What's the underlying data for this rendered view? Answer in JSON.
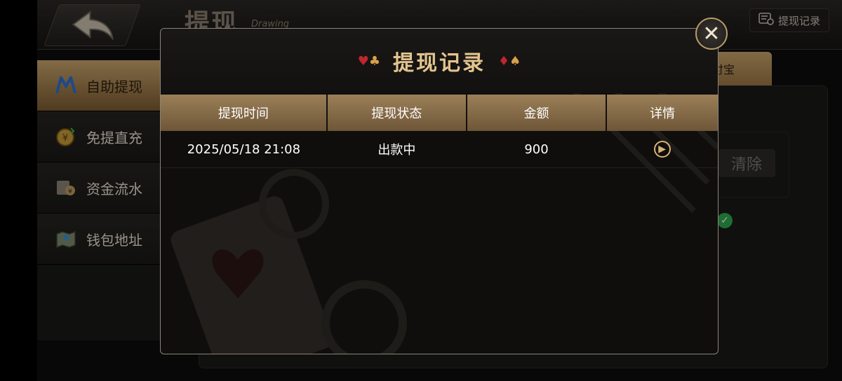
{
  "header": {
    "title": "提现",
    "subtitle": "Drawing",
    "record_link": "提现记录"
  },
  "sidebar": {
    "items": [
      {
        "label": "自助提现",
        "icon": "m-logo-icon",
        "active": true
      },
      {
        "label": "免提直充",
        "icon": "coin-icon",
        "active": false
      },
      {
        "label": "资金流水",
        "icon": "ledger-icon",
        "active": false
      },
      {
        "label": "钱包地址",
        "icon": "map-wallet-icon",
        "active": false
      }
    ]
  },
  "background": {
    "tab_label": "付宝",
    "clear_label": "清除"
  },
  "modal": {
    "title": "提现记录",
    "columns": [
      "提现时间",
      "提现状态",
      "金额",
      "详情"
    ],
    "rows": [
      {
        "time": "2025/05/18 21:08",
        "status": "出款中",
        "amount": "900"
      }
    ]
  },
  "colors": {
    "accent_gold": "#e3c48d",
    "header_bar": "#9b7f58",
    "active_sidebar": "#c9a56c"
  }
}
